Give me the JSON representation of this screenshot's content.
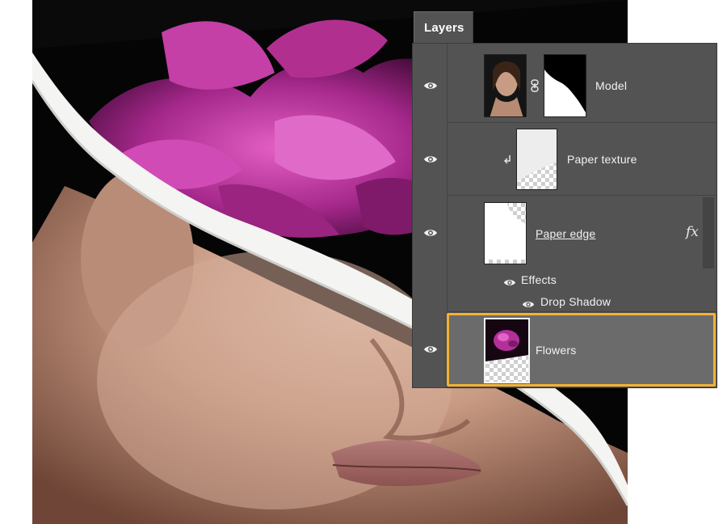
{
  "panel": {
    "title": "Layers",
    "colors": {
      "panel_bg": "#535353",
      "selected_row": "#6b6b6b",
      "selection_outline": "#f2b233"
    },
    "layers": [
      {
        "name": "Model",
        "visible": true,
        "icon": "eye-icon",
        "has_mask": true,
        "linked": true
      },
      {
        "name": "Paper texture",
        "visible": true,
        "icon": "eye-icon",
        "clipping_mask": true
      },
      {
        "name": "Paper edge",
        "visible": true,
        "icon": "eye-icon",
        "has_effects": true,
        "fx_label": "fx",
        "effects": {
          "label": "Effects",
          "items": [
            "Drop Shadow"
          ]
        }
      },
      {
        "name": "Flowers",
        "visible": true,
        "icon": "eye-icon",
        "selected": true
      }
    ]
  }
}
